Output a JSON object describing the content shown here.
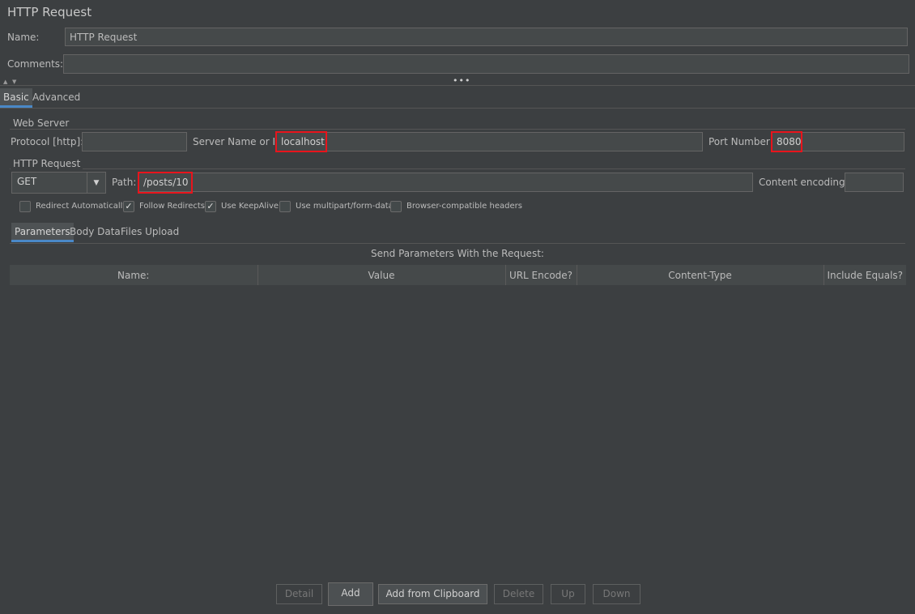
{
  "title": "HTTP Request",
  "name": {
    "label": "Name:",
    "value": "HTTP Request"
  },
  "comments": {
    "label": "Comments:",
    "value": ""
  },
  "top_tabs": [
    {
      "label": "Basic",
      "active": true
    },
    {
      "label": "Advanced",
      "active": false
    }
  ],
  "web_server": {
    "group_title": "Web Server",
    "protocol_label": "Protocol [http]:",
    "protocol_value": "",
    "server_label": "Server Name or IP:",
    "server_value": "localhost",
    "port_label": "Port Number:",
    "port_value": "8080"
  },
  "http_request": {
    "group_title": "HTTP Request",
    "method": "GET",
    "path_label": "Path:",
    "path_value": "/posts/10",
    "encoding_label": "Content encoding:",
    "encoding_value": ""
  },
  "options": [
    {
      "label": "Redirect Automatically",
      "checked": false
    },
    {
      "label": "Follow Redirects",
      "checked": true
    },
    {
      "label": "Use KeepAlive",
      "checked": true
    },
    {
      "label": "Use multipart/form-data",
      "checked": false
    },
    {
      "label": "Browser-compatible headers",
      "checked": false
    }
  ],
  "param_tabs": [
    {
      "label": "Parameters",
      "active": true
    },
    {
      "label": "Body Data",
      "active": false
    },
    {
      "label": "Files Upload",
      "active": false
    }
  ],
  "params_title": "Send Parameters With the Request:",
  "columns": [
    "Name:",
    "Value",
    "URL Encode?",
    "Content-Type",
    "Include Equals?"
  ],
  "buttons": {
    "detail": "Detail",
    "add": "Add",
    "add_clipboard": "Add from Clipboard",
    "delete": "Delete",
    "up": "Up",
    "down": "Down"
  },
  "colors": {
    "highlight": "#e8141c",
    "tab_accent": "#4a88c7",
    "background": "#3c3f41"
  },
  "icons": {
    "check": "checkmark-icon",
    "combo": "chevron-down-icon",
    "split": "expand-collapse-arrows-icon"
  }
}
